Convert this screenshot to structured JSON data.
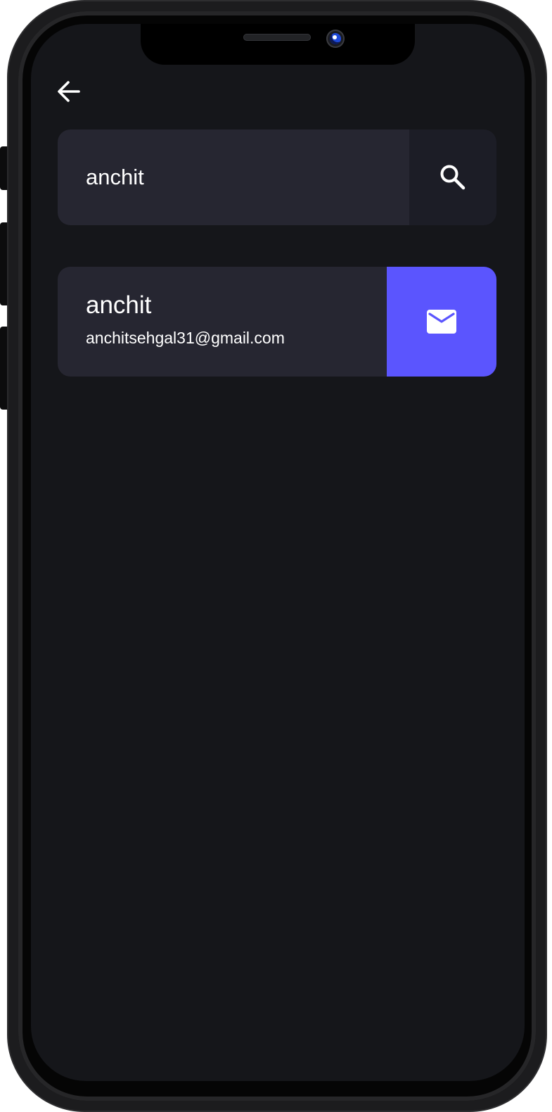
{
  "search": {
    "query": "anchit",
    "placeholder": ""
  },
  "results": [
    {
      "name": "anchit",
      "email": "anchitsehgal31@gmail.com"
    }
  ],
  "icons": {
    "back": "arrow-left-icon",
    "search": "search-icon",
    "mail": "mail-icon"
  },
  "colors": {
    "screen_background": "#15161a",
    "card_background": "#262631",
    "search_button_background": "#1c1d26",
    "accent": "#5b55fe",
    "text": "#ffffff"
  }
}
